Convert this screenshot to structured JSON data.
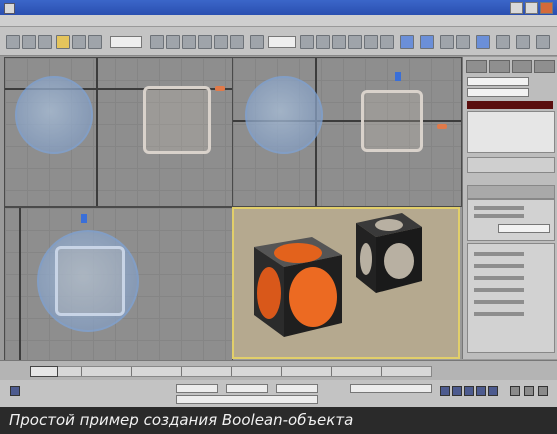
{
  "caption": "Простой пример создания Boolean-объекта",
  "colors": {
    "titlebar": "#2a4fb0",
    "viewport_bg": "#8e8e8e",
    "perspective_border": "#e2cf6a",
    "orange_sphere": "#e3621c",
    "cube": "#2c2c2c"
  },
  "icons": [
    "app-icon",
    "minimize-icon",
    "maximize-icon",
    "close-icon"
  ]
}
